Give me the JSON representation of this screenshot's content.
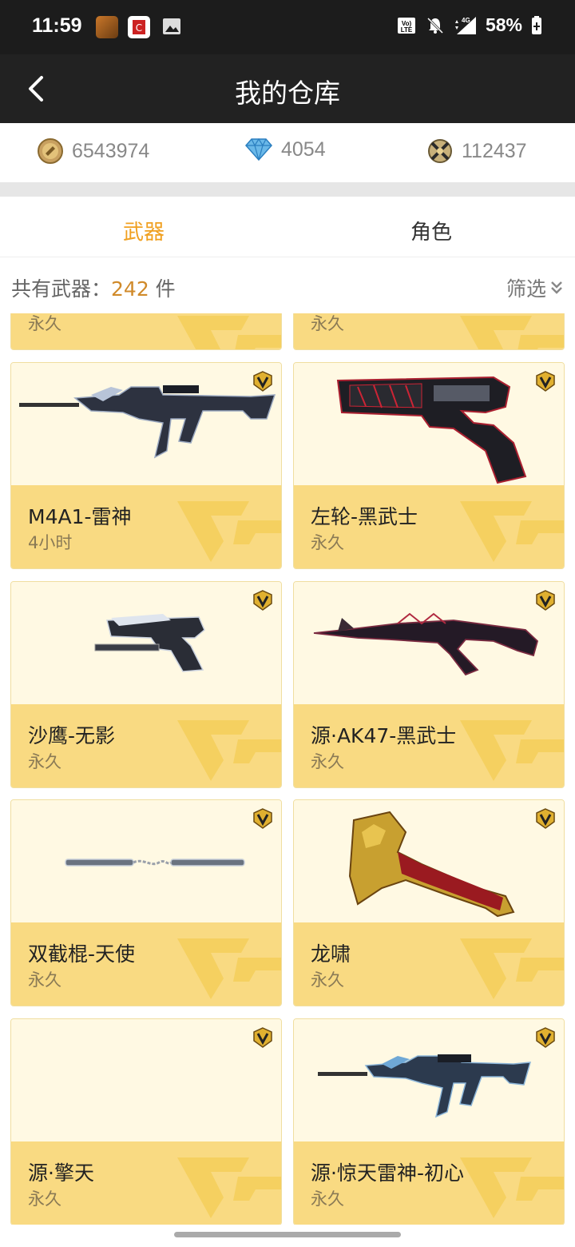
{
  "status_bar": {
    "time": "11:59",
    "network_label": "4G",
    "battery": "58%"
  },
  "nav": {
    "title": "我的仓库"
  },
  "currency": {
    "gold": "6543974",
    "diamond": "4054",
    "points": "112437"
  },
  "tabs": {
    "weapons": "武器",
    "roles": "角色"
  },
  "summary": {
    "prefix": "共有武器：",
    "count": "242",
    "suffix": " 件",
    "filter_label": "筛选"
  },
  "partial_cards": [
    {
      "duration": "永久"
    },
    {
      "duration": "永久"
    }
  ],
  "cards": [
    {
      "name": "M4A1-雷神",
      "duration": "4小时",
      "weapon_icon": "rifle-icon"
    },
    {
      "name": "左轮-黑武士",
      "duration": "永久",
      "weapon_icon": "revolver-icon"
    },
    {
      "name": "沙鹰-无影",
      "duration": "永久",
      "weapon_icon": "pistol-icon"
    },
    {
      "name": "源·AK47-黑武士",
      "duration": "永久",
      "weapon_icon": "ak-rifle-icon"
    },
    {
      "name": "双截棍-天使",
      "duration": "永久",
      "weapon_icon": "nunchaku-icon"
    },
    {
      "name": "龙啸",
      "duration": "永久",
      "weapon_icon": "dragon-axe-icon"
    },
    {
      "name": "源·擎天",
      "duration": "永久",
      "weapon_icon": ""
    },
    {
      "name": "源·惊天雷神-初心",
      "duration": "永久",
      "weapon_icon": "rifle-icon"
    }
  ],
  "colors": {
    "accent": "#f0a020",
    "card_info_bg": "#f9da82",
    "card_bg": "#fff9e3",
    "nav_bg": "#222222"
  }
}
